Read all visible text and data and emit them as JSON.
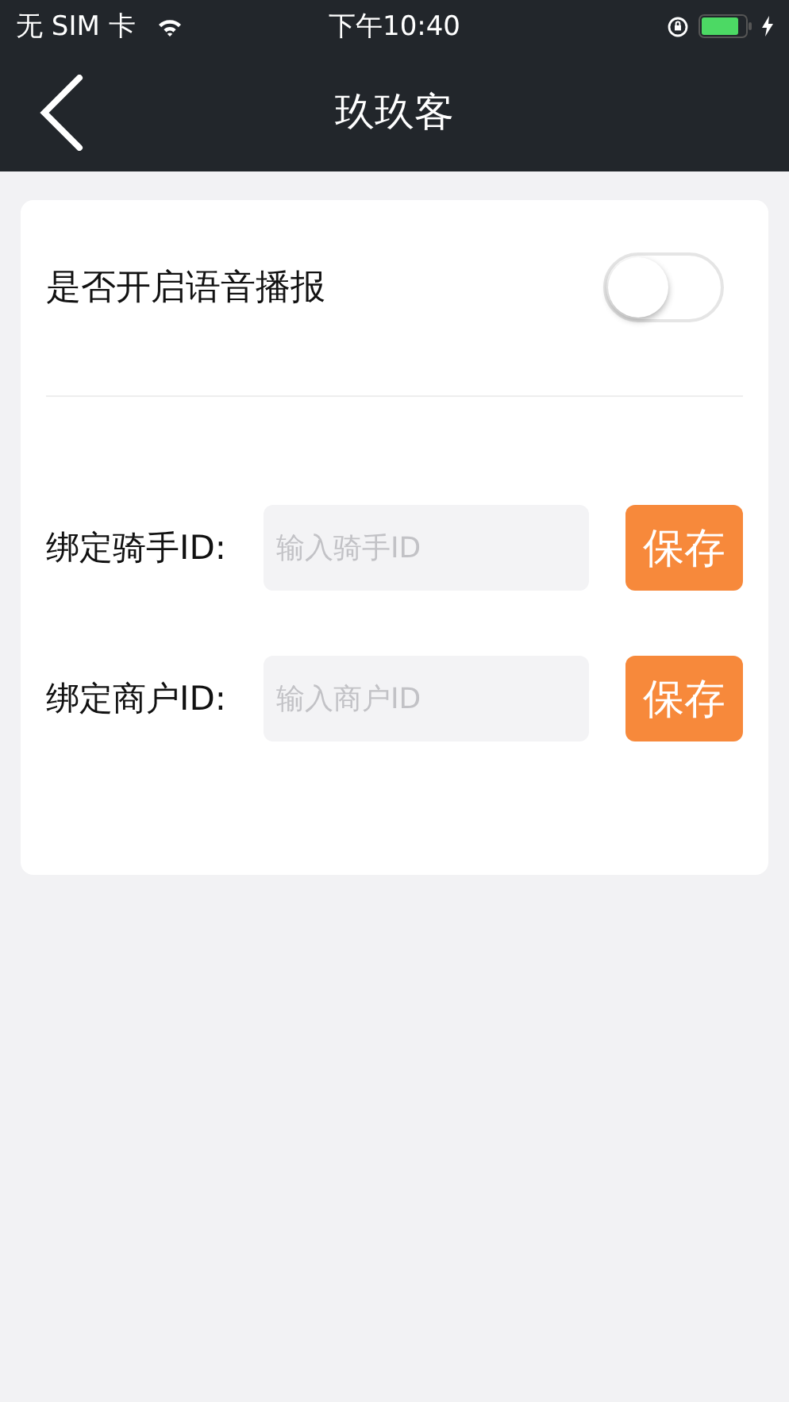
{
  "status_bar": {
    "carrier": "无 SIM 卡",
    "time": "下午10:40"
  },
  "nav": {
    "title": "玖玖客"
  },
  "voice_toggle": {
    "label": "是否开启语音播报",
    "on": false
  },
  "bindings": [
    {
      "label": "绑定骑手ID:",
      "placeholder": "输入骑手ID",
      "button": "保存"
    },
    {
      "label": "绑定商户ID:",
      "placeholder": "输入商户ID",
      "button": "保存"
    }
  ]
}
